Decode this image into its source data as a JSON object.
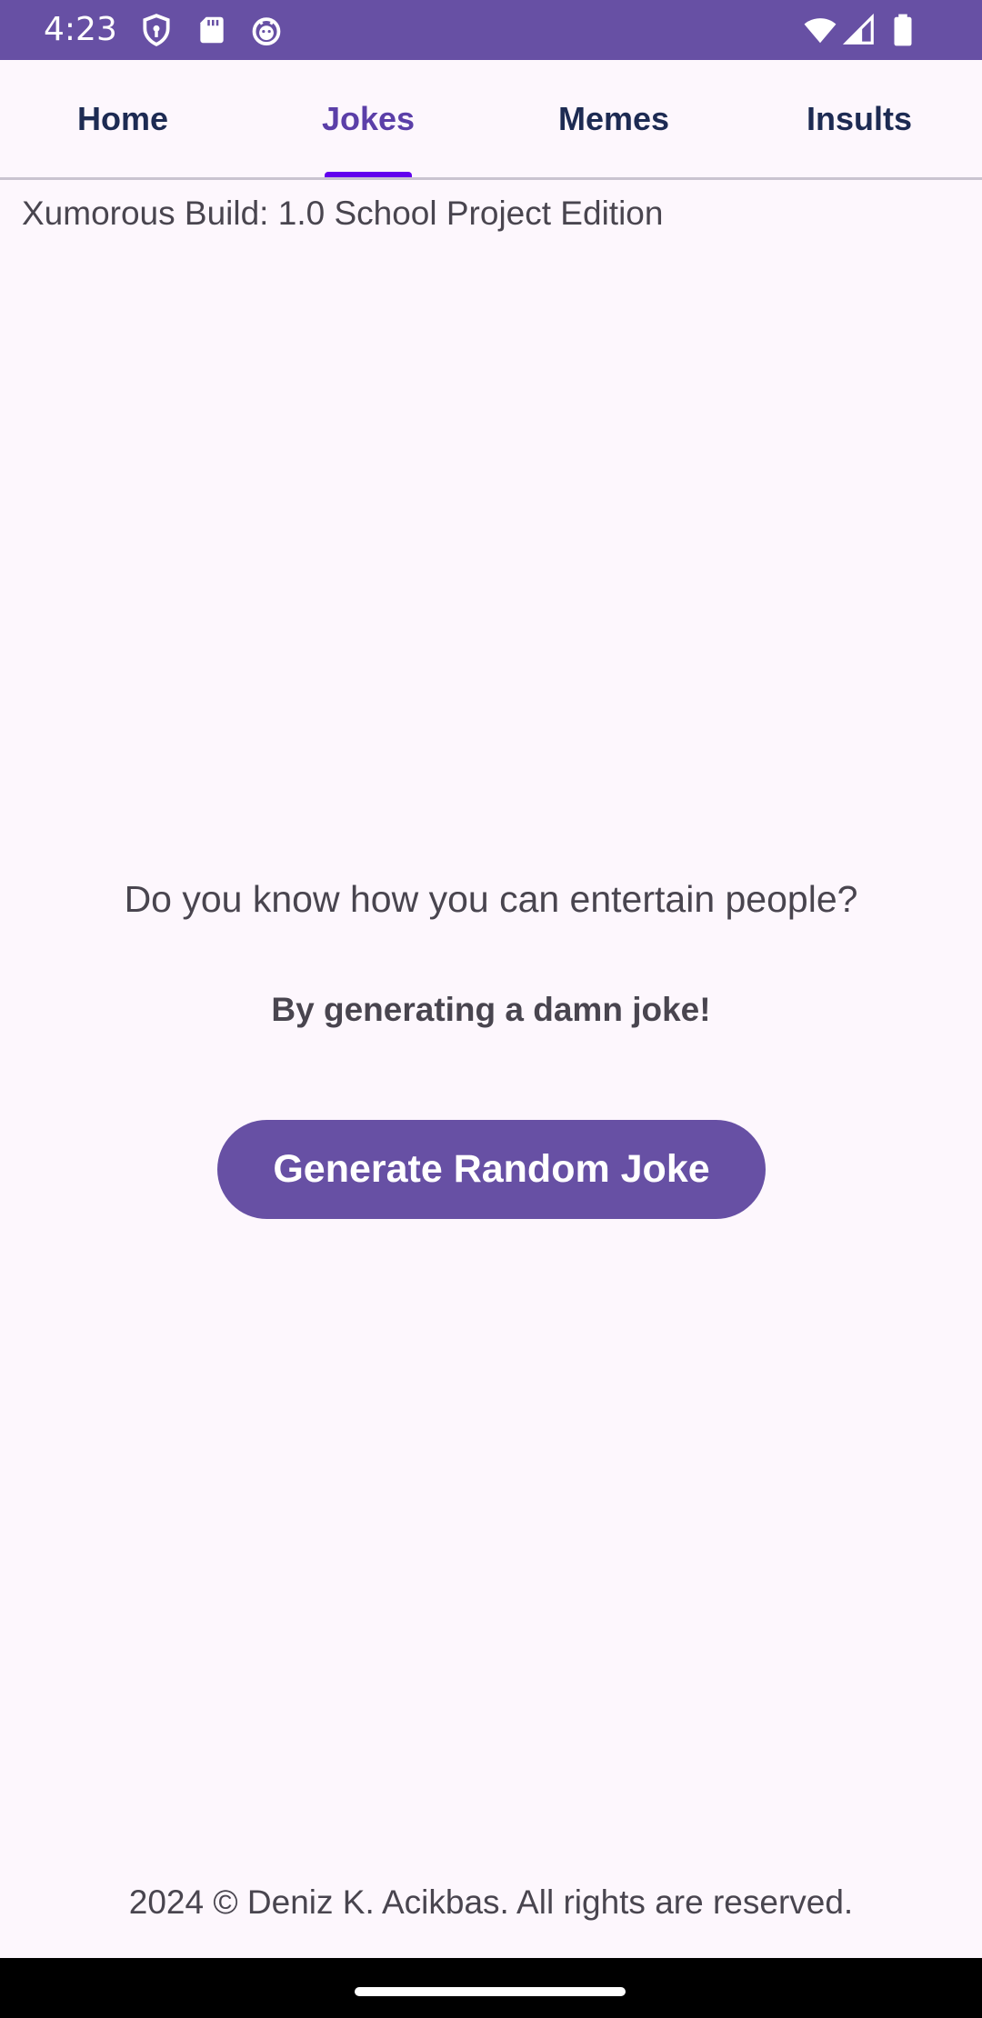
{
  "status_bar": {
    "time": "4:23",
    "icons_left": [
      "shield-icon",
      "sd-card-icon",
      "android-debug-icon"
    ],
    "icons_right": [
      "wifi-icon",
      "signal-icon",
      "battery-icon"
    ],
    "background_color": "#6750A4"
  },
  "tabs": [
    {
      "label": "Home",
      "active": false
    },
    {
      "label": "Jokes",
      "active": true
    },
    {
      "label": "Memes",
      "active": false
    },
    {
      "label": "Insults",
      "active": false
    }
  ],
  "build_info": "Xumorous Build: 1.0 School Project Edition",
  "main": {
    "question": "Do you know how you can entertain people?",
    "answer": "By generating a damn joke!",
    "button_label": "Generate Random Joke"
  },
  "footer": "2024 © Deniz K. Acikbas. All rights are reserved.",
  "colors": {
    "accent": "#6750A4",
    "tab_indicator": "#6200EE",
    "background": "#FDF7FD"
  }
}
